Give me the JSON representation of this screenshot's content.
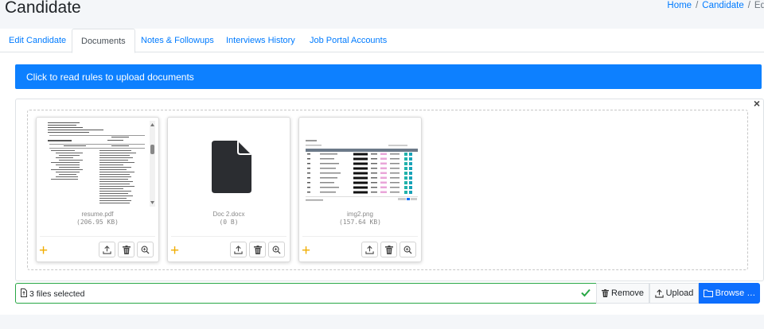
{
  "header": {
    "title": "Candidate",
    "breadcrumb": [
      "Home",
      "Candidate",
      "Ed"
    ]
  },
  "tabs": [
    {
      "label": "Edit Candidate",
      "active": false
    },
    {
      "label": "Documents",
      "active": true
    },
    {
      "label": "Notes & Followups",
      "active": false
    },
    {
      "label": "Interviews History",
      "active": false
    },
    {
      "label": "Job Portal Accounts",
      "active": false
    }
  ],
  "rules_bar": {
    "text": "Click to read rules to upload documents",
    "color": "#0d80ff"
  },
  "uploader": {
    "close_label": "×",
    "files": [
      {
        "name": "resume.pdf",
        "size": "(206.95 KB)",
        "preview": "pdf-document"
      },
      {
        "name": "Doc 2.docx",
        "size": "(0 B)",
        "preview": "file-icon"
      },
      {
        "name": "img2.png",
        "size": "(157.64 KB)",
        "preview": "table-screenshot"
      }
    ],
    "caption": "3 files selected",
    "buttons": {
      "remove": "Remove",
      "upload": "Upload",
      "browse": "Browse …"
    },
    "icons": {
      "upload": "upload-icon",
      "delete": "trash-icon",
      "zoom": "zoom-icon",
      "add": "plus-icon",
      "check": "check-icon",
      "folder": "folder-icon"
    }
  }
}
